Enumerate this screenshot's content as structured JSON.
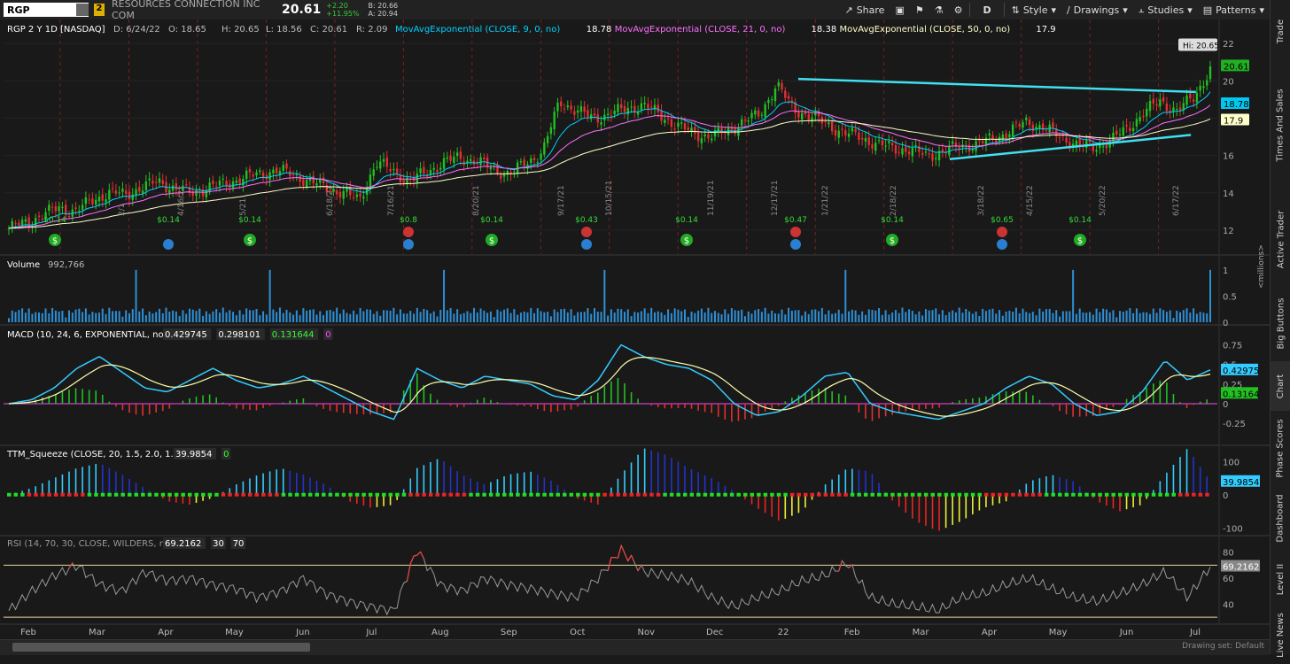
{
  "toolbar": {
    "symbol": "RGP",
    "link_badge": "2",
    "company": "RESOURCES CONNECTION INC COM",
    "last": "20.61",
    "change": "+2.20",
    "change_pct": "+11.95%",
    "bid": "B: 20.66",
    "ask": "A: 20.94",
    "share": "Share",
    "period": "D",
    "style": "Style",
    "drawings": "Drawings",
    "studies": "Studies",
    "patterns": "Patterns",
    "icons": [
      "share-icon",
      "screenshot-icon",
      "flag-icon",
      "flask-icon",
      "gear-icon",
      "style-icon",
      "drawings-icon",
      "studies-icon",
      "patterns-icon"
    ]
  },
  "sidebar": {
    "tabs": [
      "Trade",
      "Times And Sales",
      "Active Trader",
      "Big Buttons",
      "Chart",
      "Phase Scores",
      "Dashboard",
      "Level II",
      "Live News"
    ]
  },
  "status": {
    "label": "Drawing set: Default"
  },
  "colors": {
    "bg": "#1a1a1a",
    "grid": "#2a2a2a",
    "up": "#22c022",
    "down": "#e03030",
    "ema9": "#00d0ff",
    "ema21": "#ff70ff",
    "ema50": "#ffffcc",
    "trend": "#40e0f0",
    "volume": "#2e8fd6",
    "macd": "#33ccff",
    "signal": "#ffffaa",
    "rsi": "#9a9a9a"
  },
  "chart_data": [
    {
      "type": "candlestick",
      "title": "RGP 2 Y 1D [NASDAQ]",
      "ohlc_label": {
        "date": "D: 6/24/22",
        "open": "O: 18.65",
        "high": "H: 20.65",
        "low": "L: 18.56",
        "close": "C: 20.61",
        "range": "R: 2.09"
      },
      "studies": [
        {
          "name": "MovAvgExponential (CLOSE, 9, 0, no)",
          "value": "18.78",
          "color": "#00d0ff"
        },
        {
          "name": "MovAvgExponential (CLOSE, 21, 0, no)",
          "value": "18.38",
          "color": "#ff70ff"
        },
        {
          "name": "MovAvgExponential (CLOSE, 50, 0, no)",
          "value": "17.9",
          "color": "#ffffcc"
        }
      ],
      "hi_label": "Hi: 20.65",
      "price_tags": [
        {
          "text": "20.61",
          "value": 20.61,
          "color": "#22b022"
        },
        {
          "text": "18.78",
          "value": 18.78,
          "color": "#00c8f0"
        },
        {
          "text": "17.9",
          "value": 17.9,
          "color": "#ffffcc"
        }
      ],
      "ylim": [
        11,
        23
      ],
      "yticks": [
        12,
        14,
        16,
        18,
        20,
        22
      ],
      "x_months": [
        "Feb",
        "Mar",
        "Apr",
        "May",
        "Jun",
        "Jul",
        "Aug",
        "Sep",
        "Oct",
        "Nov",
        "Dec",
        "22",
        "Feb",
        "Mar",
        "Apr",
        "May",
        "Jun",
        "Jul"
      ],
      "close_path": [
        12.1,
        12.4,
        12.8,
        13.2,
        13.0,
        13.6,
        14.0,
        13.9,
        14.3,
        14.6,
        14.2,
        14.0,
        14.3,
        14.5,
        14.8,
        15.0,
        15.2,
        15.0,
        14.6,
        14.3,
        14.0,
        13.6,
        15.6,
        15.2,
        14.6,
        15.1,
        15.6,
        15.9,
        15.7,
        15.3,
        15.0,
        15.6,
        16.2,
        18.9,
        18.4,
        18.0,
        18.2,
        18.5,
        18.7,
        18.2,
        17.6,
        17.2,
        17.0,
        17.3,
        17.8,
        18.2,
        19.8,
        18.5,
        18.1,
        17.7,
        17.2,
        17.0,
        16.6,
        16.4,
        16.3,
        16.0,
        16.2,
        16.5,
        16.6,
        16.9,
        17.3,
        17.8,
        17.5,
        17.0,
        16.6,
        16.4,
        16.8,
        17.4,
        18.3,
        18.9,
        18.4,
        19.1,
        20.61
      ],
      "trendlines": [
        {
          "label": "upper",
          "from": [
            0.6188,
            20.1
          ],
          "to": [
            0.9271,
            19.4
          ]
        },
        {
          "label": "lower",
          "from": [
            0.7362,
            15.8
          ],
          "to": [
            0.9232,
            17.1
          ]
        }
      ],
      "dividend_labels": [
        "$0.14",
        "$0.14",
        "$0.14",
        "$0.14",
        "$0.14",
        "$0.14",
        "$0.14"
      ],
      "earnings_labels": [
        "$0.8",
        "$0.43",
        "$0.47",
        "$0.65"
      ],
      "date_labels": [
        "2/1",
        "4/16/21",
        "5/21",
        "6/18/21",
        "7/16/21",
        "8/20/21",
        "9/17/21",
        "10/15/21",
        "11/19/21",
        "12/17/21",
        "1/21/22",
        "2/18/22",
        "3/18/22",
        "4/15/22",
        "5/20/22",
        "6/17/22"
      ]
    },
    {
      "type": "bar",
      "title": "Volume",
      "value_label": "992,766",
      "ylabel": "<millions>",
      "yticks": [
        "1",
        "0.5",
        "0"
      ],
      "ylim": [
        0,
        1.2
      ]
    },
    {
      "type": "line",
      "title": "MACD (10, 24, 6, EXPONENTIAL, no)",
      "values": [
        "0.429745",
        "0.298101",
        "0.131644",
        "0"
      ],
      "price_tags": [
        {
          "text": "0.42975",
          "value": 0.42975,
          "color": "#33ccff"
        },
        {
          "text": "0.13164",
          "value": 0.13164,
          "color": "#22c022"
        }
      ],
      "yticks": [
        "0.75",
        "0.5",
        "0.25",
        "0",
        "-0.25"
      ],
      "ylim": [
        -0.45,
        0.9
      ],
      "macd_path": [
        0.0,
        0.05,
        0.2,
        0.45,
        0.6,
        0.4,
        0.2,
        0.15,
        0.3,
        0.45,
        0.3,
        0.2,
        0.25,
        0.35,
        0.2,
        0.05,
        -0.1,
        -0.2,
        0.45,
        0.3,
        0.2,
        0.35,
        0.3,
        0.25,
        0.1,
        0.05,
        0.3,
        0.75,
        0.6,
        0.5,
        0.45,
        0.3,
        0.0,
        -0.15,
        -0.1,
        0.1,
        0.35,
        0.4,
        0.0,
        -0.1,
        -0.15,
        -0.2,
        -0.1,
        0.0,
        0.2,
        0.35,
        0.25,
        0.0,
        -0.15,
        -0.1,
        0.15,
        0.55,
        0.3,
        0.43
      ]
    },
    {
      "type": "bar",
      "title": "TTM_Squeeze (CLOSE, 20, 1.5, 2.0, 1.0)",
      "values": [
        "39.9854",
        "0"
      ],
      "price_tags": [
        {
          "text": "39.9854",
          "value": 39.9854,
          "color": "#33ccff"
        }
      ],
      "yticks": [
        "100",
        "50",
        "0",
        "-100"
      ],
      "ylim": [
        -110,
        130
      ],
      "mom_path": [
        0,
        20,
        50,
        80,
        95,
        60,
        20,
        -20,
        -30,
        -10,
        30,
        60,
        80,
        60,
        30,
        -20,
        -40,
        -30,
        80,
        110,
        60,
        30,
        60,
        70,
        40,
        -10,
        -30,
        60,
        140,
        120,
        80,
        50,
        10,
        -40,
        -80,
        -50,
        30,
        80,
        70,
        -20,
        -80,
        -110,
        -80,
        -40,
        -20,
        40,
        60,
        40,
        -20,
        -50,
        -30,
        60,
        140,
        40
      ]
    },
    {
      "type": "line",
      "title": "RSI (14, 70, 30, CLOSE, WILDERS, no)",
      "values": [
        "69.2162",
        "30",
        "70"
      ],
      "price_tags": [
        {
          "text": "69.2162",
          "value": 69.2162,
          "color": "#888888"
        }
      ],
      "yticks": [
        "80",
        "60",
        "40"
      ],
      "ylim": [
        28,
        88
      ],
      "rsi_path": [
        35,
        50,
        62,
        70,
        55,
        50,
        65,
        58,
        60,
        55,
        52,
        45,
        50,
        60,
        48,
        42,
        38,
        35,
        82,
        55,
        50,
        60,
        55,
        52,
        48,
        45,
        60,
        82,
        65,
        62,
        58,
        45,
        38,
        45,
        50,
        58,
        62,
        72,
        45,
        40,
        38,
        35,
        45,
        48,
        55,
        60,
        52,
        45,
        42,
        48,
        55,
        65,
        45,
        69
      ]
    }
  ]
}
